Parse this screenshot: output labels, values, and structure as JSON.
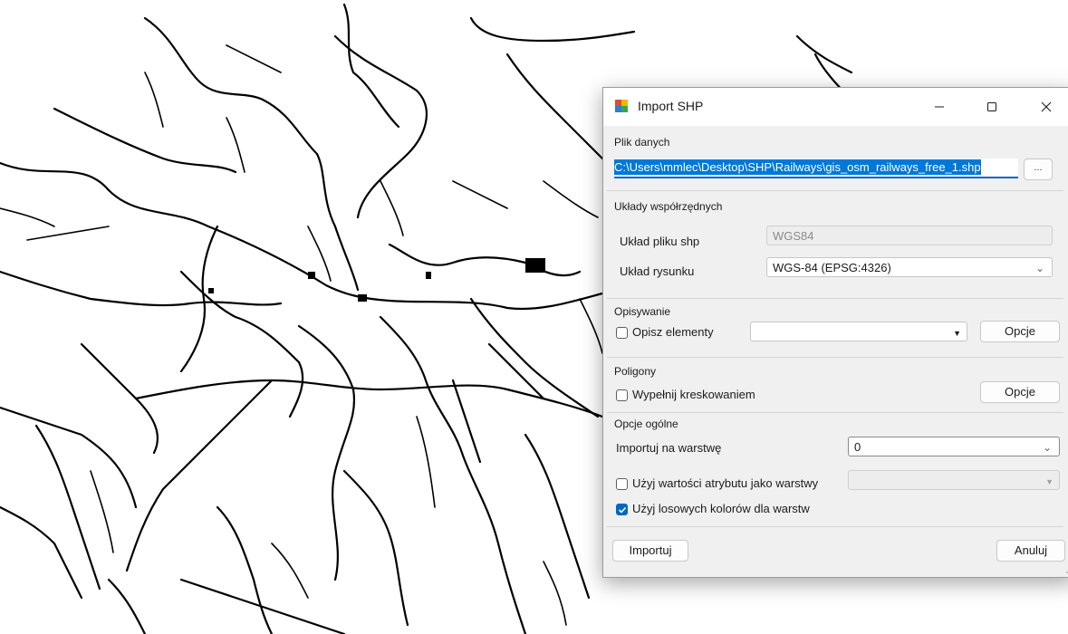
{
  "window": {
    "title": "Import SHP"
  },
  "file_group": {
    "label": "Plik danych",
    "path_value": "C:\\Users\\mmlec\\Desktop\\SHP\\Railways\\gis_osm_railways_free_1.shp",
    "browse_label": "..."
  },
  "coords_group": {
    "label": "Układy współrzędnych",
    "shp_label": "Układ pliku shp",
    "shp_value": "WGS84",
    "drawing_label": "Układ rysunku",
    "drawing_value": "WGS-84 (EPSG:4326)"
  },
  "describe_group": {
    "label": "Opisywanie",
    "checkbox_label": "Opisz elementy",
    "checked": false,
    "dropdown_value": "",
    "options_label": "Opcje"
  },
  "polygons_group": {
    "label": "Poligony",
    "checkbox_label": "Wypełnij kreskowaniem",
    "checked": false,
    "options_label": "Opcje"
  },
  "general_group": {
    "label": "Opcje ogólne",
    "import_layer_label": "Importuj na warstwę",
    "import_layer_value": "0",
    "attr_checkbox_label": "Użyj wartości atrybutu jako warstwy",
    "attr_checked": false,
    "attr_dropdown_value": "",
    "random_colors_label": "Użyj losowych kolorów dla warstw",
    "random_colors_checked": true
  },
  "footer": {
    "import_label": "Importuj",
    "cancel_label": "Anuluj"
  },
  "colors": {
    "accent": "#0067c0",
    "selection": "#0078d7",
    "dialog_bg": "#f0f0f0"
  }
}
